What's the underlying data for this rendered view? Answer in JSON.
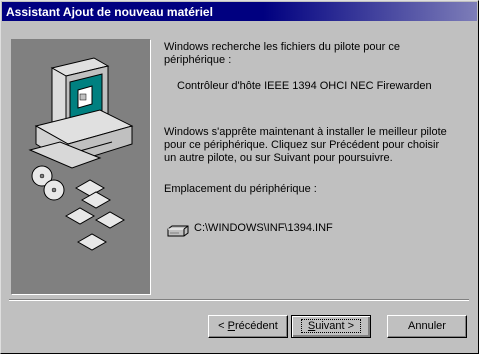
{
  "window": {
    "title": "Assistant Ajout de nouveau matériel"
  },
  "content": {
    "searching_line1": "Windows recherche les fichiers du pilote pour ce",
    "searching_line2": "périphérique :",
    "device_name": "Contrôleur d'hôte IEEE 1394 OHCI NEC Firewarden",
    "install_line1": "Windows s'apprête maintenant à installer le meilleur pilote",
    "install_line2": "pour ce périphérique. Cliquez sur Précédent pour choisir",
    "install_line3": "un autre pilote, ou sur Suivant pour poursuivre.",
    "location_label": "Emplacement du périphérique :",
    "location_path": "C:\\WINDOWS\\INF\\1394.INF"
  },
  "buttons": {
    "back_prefix": "< ",
    "back_accel": "P",
    "back_rest": "récédent",
    "next_accel": "S",
    "next_rest": "uivant >",
    "cancel": "Annuler"
  },
  "icons": {
    "wizard_art": "computer-with-discs",
    "location": "drive-icon"
  }
}
